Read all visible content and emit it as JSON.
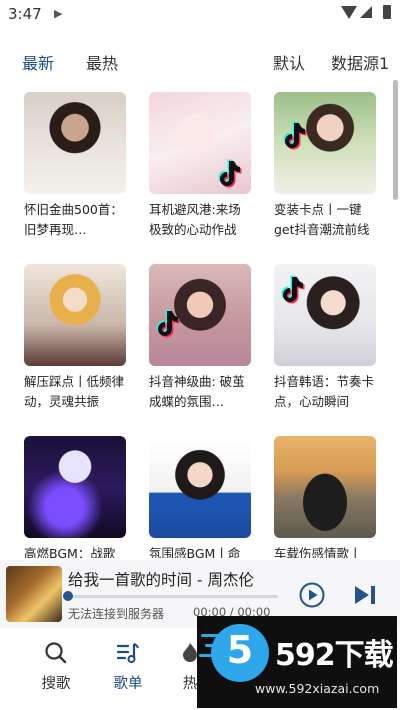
{
  "status_bar": {
    "time": "3:47"
  },
  "tabs": {
    "latest": "最新",
    "hottest": "最热",
    "default": "默认",
    "source": "数据源1"
  },
  "playlists": [
    {
      "title": "怀旧金曲500首：旧梦再现…",
      "badge_icon": ""
    },
    {
      "title": "耳机避风港:来场极致的心动作战",
      "badge_icon": "tiktok-icon"
    },
    {
      "title": "变装卡点丨一键get抖音潮流前线",
      "badge_icon": "tiktok-icon"
    },
    {
      "title": "解压踩点丨低频律动，灵魂共振",
      "badge_icon": ""
    },
    {
      "title": "抖音神级曲: 破茧成蝶的氛围…",
      "badge_icon": "tiktok-icon"
    },
    {
      "title": "抖音韩语：节奏卡点，心动瞬间",
      "badge_icon": "tiktok-icon"
    },
    {
      "title": "高燃BGM：战歌",
      "badge_icon": ""
    },
    {
      "title": "氛围感BGM丨命",
      "badge_icon": ""
    },
    {
      "title": "车载伤感情歌丨",
      "badge_icon": ""
    }
  ],
  "player": {
    "song": "给我一首歌的时间 - 周杰伦",
    "message": "无法连接到服务器",
    "time": "00:00 / 00:00",
    "progress": 0
  },
  "nav": {
    "search": "搜歌",
    "playlist": "歌单",
    "hot": "热"
  },
  "watermark": {
    "brand": "592下载",
    "url": "www.592xiazai.com"
  },
  "colors": {
    "accent": "#1c4c86",
    "tiktok_cyan": "#25f4ee",
    "tiktok_red": "#fe2c55"
  }
}
